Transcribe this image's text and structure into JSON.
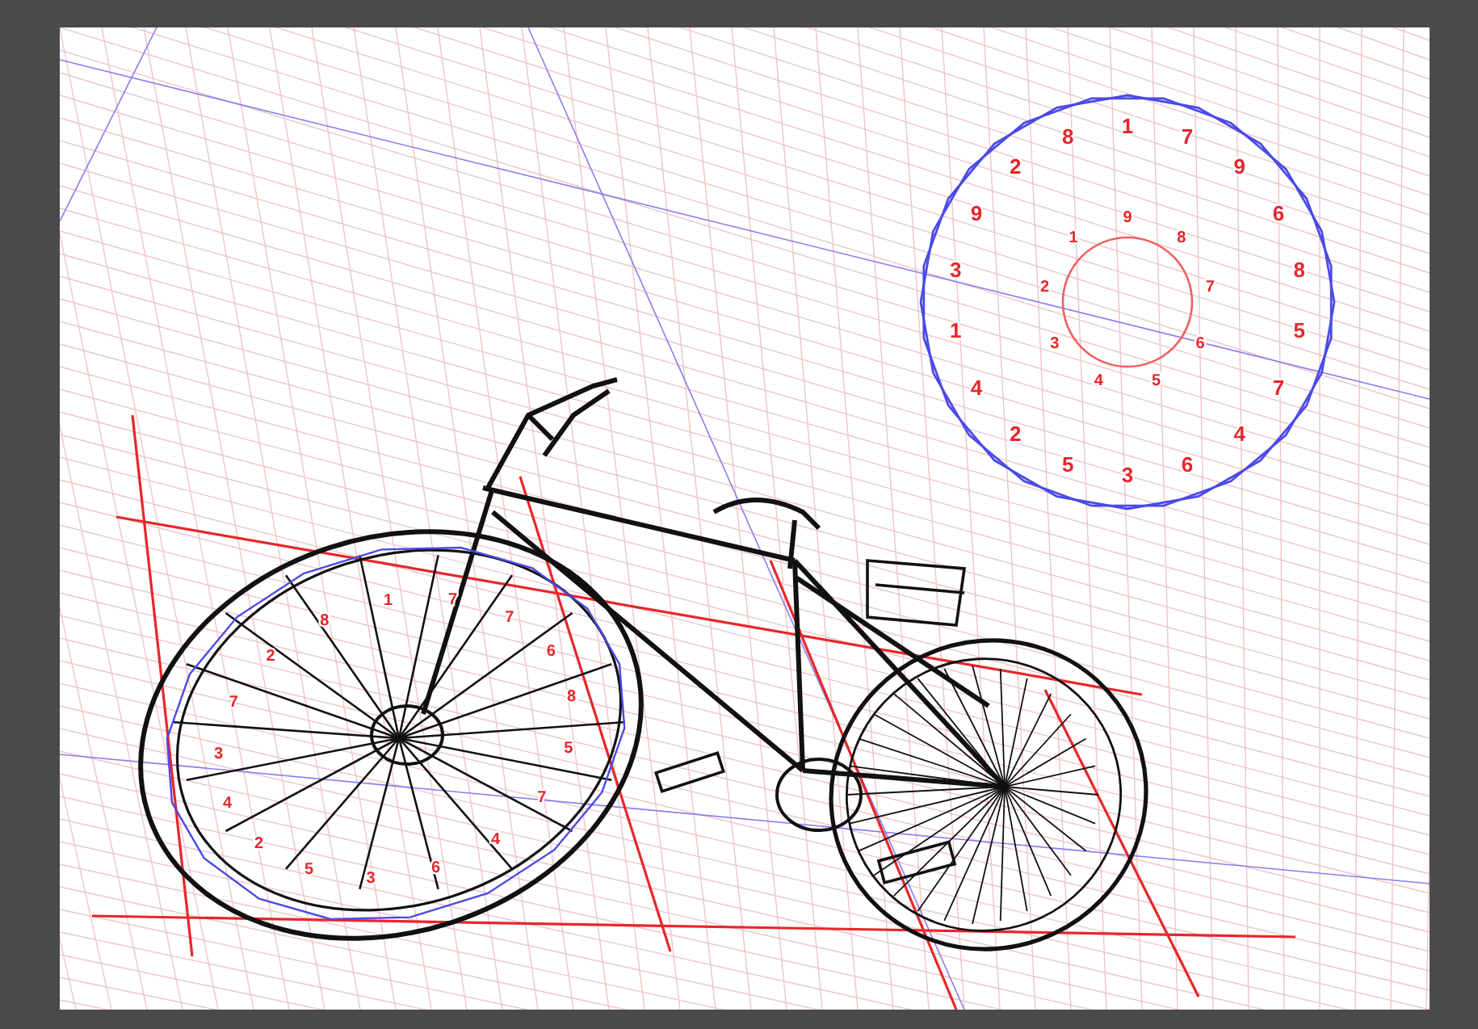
{
  "canvas": {
    "clock": {
      "outer_numbers": [
        "1",
        "7",
        "9",
        "6",
        "8",
        "5",
        "7",
        "4",
        "6",
        "3",
        "5",
        "2",
        "4",
        "1",
        "3",
        "9",
        "2",
        "8"
      ],
      "inner_numbers": [
        "9",
        "8",
        "7",
        "6",
        "5",
        "4",
        "3",
        "2",
        "1"
      ]
    },
    "front_wheel": {
      "numbers": [
        "1",
        "7",
        "7",
        "6",
        "8",
        "5",
        "7",
        "4",
        "6",
        "3",
        "5",
        "2",
        "4",
        "3",
        "7",
        "2",
        "8"
      ]
    }
  }
}
